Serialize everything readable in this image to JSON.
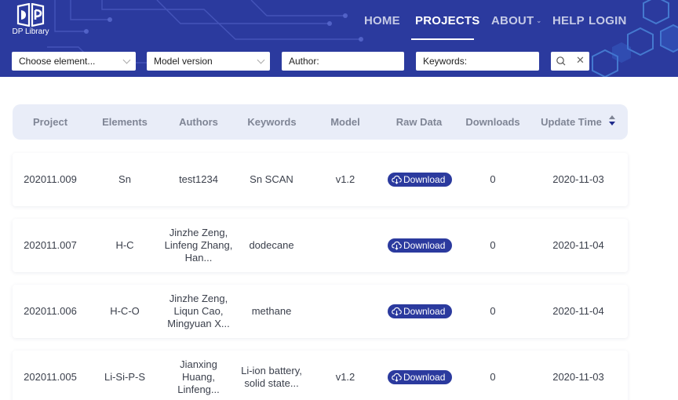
{
  "brand": {
    "logo_text": "DP Library"
  },
  "nav": {
    "home": "HOME",
    "projects": "PROJECTS",
    "about": "ABOUT",
    "help": "HELP",
    "login": "LOGIN"
  },
  "filters": {
    "element": "Choose element...",
    "model_version": "Model version",
    "author": "Author:",
    "keywords": "Keywords:"
  },
  "table": {
    "headers": [
      "Project",
      "Elements",
      "Authors",
      "Keywords",
      "Model",
      "Raw Data",
      "Downloads",
      "Update Time"
    ],
    "download_label": "Download",
    "rows": [
      {
        "project": "202011.009",
        "elements": "Sn",
        "authors": "test1234",
        "keywords": "Sn SCAN",
        "model": "v1.2",
        "downloads": "0",
        "update_time": "2020-11-03"
      },
      {
        "project": "202011.007",
        "elements": "H-C",
        "authors": "Jinzhe Zeng, Linfeng Zhang, Han...",
        "keywords": "dodecane",
        "model": "",
        "downloads": "0",
        "update_time": "2020-11-04"
      },
      {
        "project": "202011.006",
        "elements": "H-C-O",
        "authors": "Jinzhe Zeng, Liqun Cao, Mingyuan X...",
        "keywords": "methane",
        "model": "",
        "downloads": "0",
        "update_time": "2020-11-04"
      },
      {
        "project": "202011.005",
        "elements": "Li-Si-P-S",
        "authors": "Jianxing Huang, Linfeng...",
        "keywords": "Li-ion battery, solid state...",
        "model": "v1.2",
        "downloads": "0",
        "update_time": "2020-11-03"
      }
    ]
  },
  "colors": {
    "header_bg": "#2b3a9e",
    "button_bg": "#2b3a9e",
    "table_header_bg": "#e9edf8"
  },
  "icons": {
    "search": "search-icon",
    "clear": "close-icon",
    "download": "cloud-download-icon",
    "sort": "sort-icon"
  }
}
